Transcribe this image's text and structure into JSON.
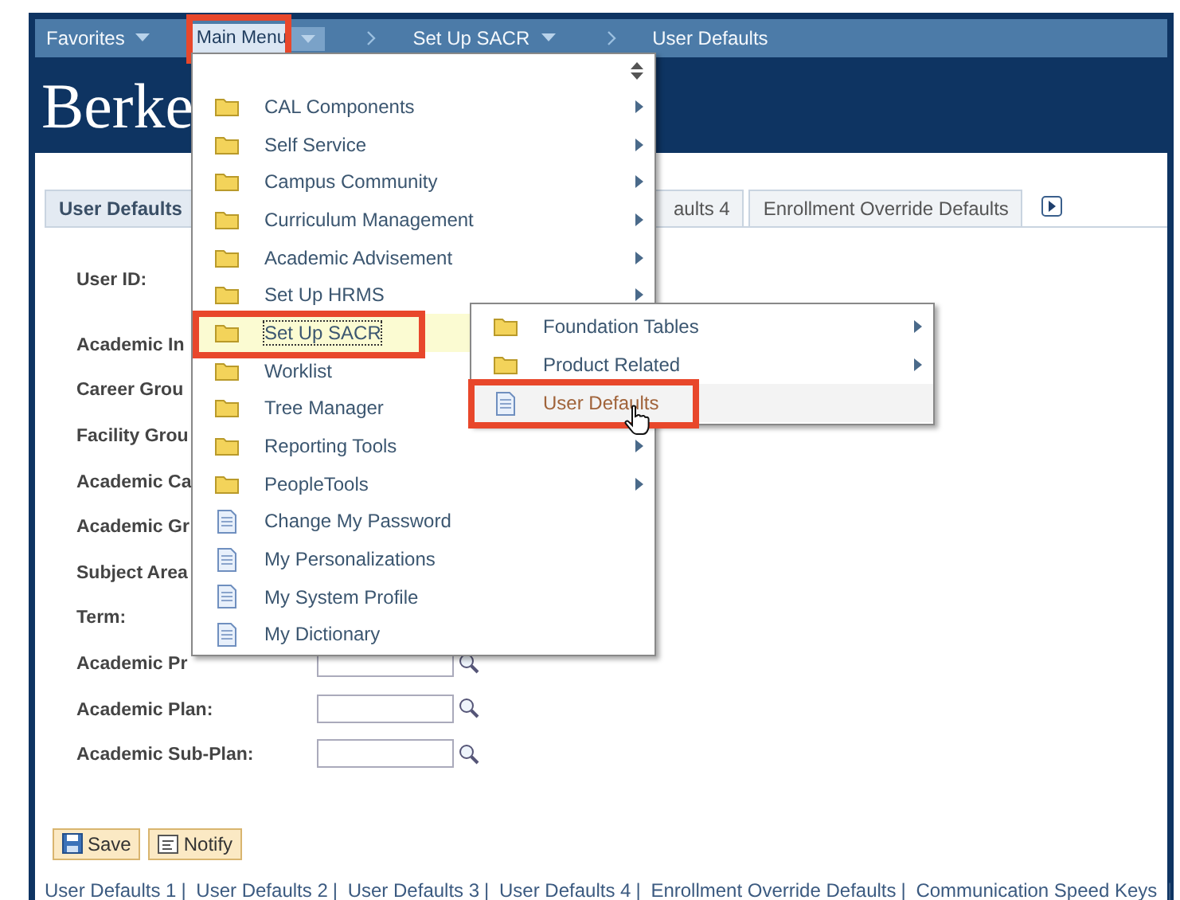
{
  "nav": {
    "items": [
      {
        "label": "Favorites",
        "kind": "menu",
        "caret": true,
        "selected": false,
        "annotated": false
      },
      {
        "label": "Main Menu",
        "kind": "menu",
        "caret": true,
        "selected": true,
        "annotated": true
      },
      {
        "label": "Set Up SACR",
        "kind": "breadcrumb",
        "caret": true,
        "selected": false,
        "annotated": false
      },
      {
        "label": "User Defaults",
        "kind": "breadcrumb",
        "caret": false,
        "selected": false,
        "annotated": false
      }
    ]
  },
  "banner": {
    "logo": "Berke"
  },
  "tabs": [
    {
      "label": "User Defaults",
      "selected": true
    },
    {
      "label": "aults 4",
      "selected": false
    },
    {
      "label": "Enrollment Override Defaults",
      "selected": false
    }
  ],
  "form": [
    {
      "label": "User ID:",
      "kind": "none"
    },
    {
      "label": "Academic In",
      "kind": "none"
    },
    {
      "label": "Career Grou",
      "kind": "none"
    },
    {
      "label": "Facility Grou",
      "kind": "none"
    },
    {
      "label": "Academic Ca",
      "kind": "none"
    },
    {
      "label": "Academic Gr",
      "kind": "none"
    },
    {
      "label": "Subject Area",
      "kind": "none"
    },
    {
      "label": "Term:",
      "kind": "none"
    },
    {
      "label": "Academic Pr",
      "kind": "lookup"
    },
    {
      "label": "Academic Plan:",
      "kind": "lookup"
    },
    {
      "label": "Academic Sub-Plan:",
      "kind": "lookup"
    }
  ],
  "buttons": [
    {
      "label": "Save",
      "kind": "save"
    },
    {
      "label": "Notify",
      "kind": "notify"
    }
  ],
  "footer_links": {
    "separator": "|",
    "links": [
      "User Defaults 1",
      "User Defaults 2",
      "User Defaults 3",
      "User Defaults 4",
      "Enrollment Override Defaults",
      "Communication Speed Keys"
    ]
  },
  "main_menu": {
    "items": [
      {
        "label": "CAL Components",
        "kind": "folder",
        "submenu": true,
        "selected": false,
        "annotated": false
      },
      {
        "label": "Self Service",
        "kind": "folder",
        "submenu": true,
        "selected": false,
        "annotated": false
      },
      {
        "label": "Campus Community",
        "kind": "folder",
        "submenu": true,
        "selected": false,
        "annotated": false
      },
      {
        "label": "Curriculum Management",
        "kind": "folder",
        "submenu": true,
        "selected": false,
        "annotated": false
      },
      {
        "label": "Academic Advisement",
        "kind": "folder",
        "submenu": true,
        "selected": false,
        "annotated": false
      },
      {
        "label": "Set Up HRMS",
        "kind": "folder",
        "submenu": true,
        "selected": false,
        "annotated": false
      },
      {
        "label": "Set Up SACR",
        "kind": "folder",
        "submenu": false,
        "selected": true,
        "annotated": true
      },
      {
        "label": "Worklist",
        "kind": "folder",
        "submenu": false,
        "selected": false,
        "annotated": false
      },
      {
        "label": "Tree Manager",
        "kind": "folder",
        "submenu": false,
        "selected": false,
        "annotated": false
      },
      {
        "label": "Reporting Tools",
        "kind": "folder",
        "submenu": true,
        "selected": false,
        "annotated": false
      },
      {
        "label": "PeopleTools",
        "kind": "folder",
        "submenu": true,
        "selected": false,
        "annotated": false
      },
      {
        "label": "Change My Password",
        "kind": "page",
        "submenu": false,
        "selected": false,
        "annotated": false
      },
      {
        "label": "My Personalizations",
        "kind": "page",
        "submenu": false,
        "selected": false,
        "annotated": false
      },
      {
        "label": "My System Profile",
        "kind": "page",
        "submenu": false,
        "selected": false,
        "annotated": false
      },
      {
        "label": "My Dictionary",
        "kind": "page",
        "submenu": false,
        "selected": false,
        "annotated": false
      }
    ]
  },
  "sub_menu": {
    "items": [
      {
        "label": "Foundation Tables",
        "kind": "folder",
        "submenu": true,
        "selected": false,
        "annotated": false
      },
      {
        "label": "Product Related",
        "kind": "folder",
        "submenu": true,
        "selected": false,
        "annotated": false
      },
      {
        "label": "User Defaults",
        "kind": "page",
        "submenu": false,
        "selected": true,
        "annotated": true
      }
    ]
  }
}
